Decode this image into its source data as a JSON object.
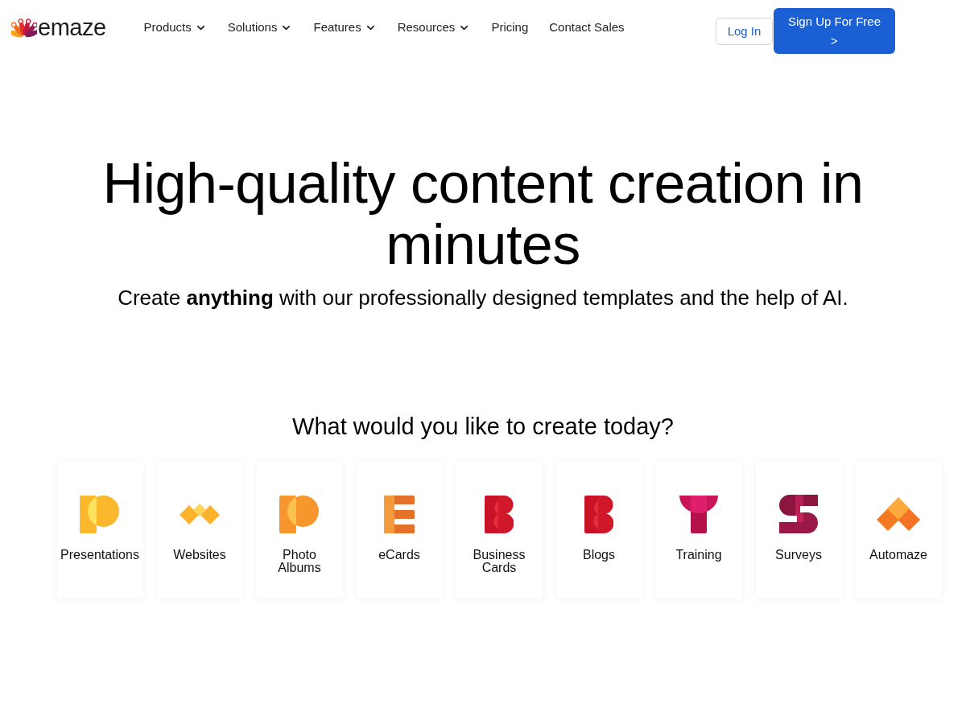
{
  "header": {
    "logo": {
      "text": "emaze"
    },
    "nav": [
      {
        "label": "Products",
        "dropdown": true
      },
      {
        "label": "Solutions",
        "dropdown": true
      },
      {
        "label": "Features",
        "dropdown": true
      },
      {
        "label": "Resources",
        "dropdown": true
      },
      {
        "label": "Pricing",
        "dropdown": false
      },
      {
        "label": "Contact Sales",
        "dropdown": false
      }
    ],
    "login_button": "Log In",
    "signup_button": {
      "label": "Sign Up For Free",
      "arrow": ">"
    }
  },
  "hero": {
    "title": "High-quality content creation in minutes",
    "subtitle": "Create **anything** with our professionally designed templates and the help of AI."
  },
  "create_section": {
    "heading": "What would you like to create today?",
    "cards": [
      {
        "label": "Presentations"
      },
      {
        "label": "Websites"
      },
      {
        "label": "Photo Albums"
      },
      {
        "label": "eCards"
      },
      {
        "label": "Business Cards"
      },
      {
        "label": "Blogs"
      },
      {
        "label": "Training"
      },
      {
        "label": "Surveys"
      },
      {
        "label": "Automaze"
      }
    ]
  }
}
